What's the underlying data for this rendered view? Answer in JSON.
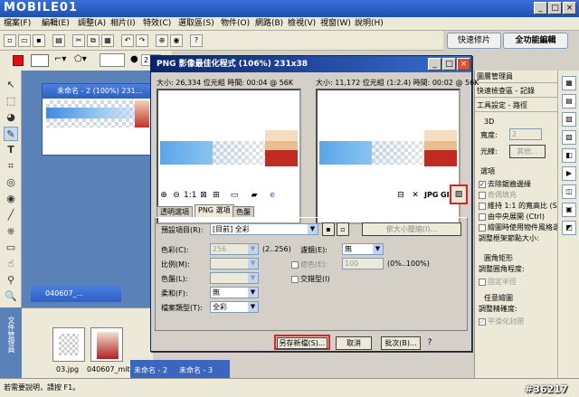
{
  "app": {
    "logo": "MOBILE01",
    "watermark": "#36217",
    "status": "若需要說明，請按 F1。"
  },
  "menubar": [
    "檔案(F)",
    "編輯(E)",
    "調整(A)",
    "相片(I)",
    "特效(C)",
    "選取區(S)",
    "物件(O)",
    "網路(B)",
    "檢視(V)",
    "視窗(W)",
    "說明(H)"
  ],
  "toolbar": {
    "tab_quick_photo": "快速修片",
    "tab_full_edit": "全功能編輯",
    "zoom_value": "2"
  },
  "documents": {
    "doc1_title": "未命名 - 2 (100%) 231...",
    "doc2_title": "040607_..."
  },
  "file_manager": {
    "side_label": "文件管理員",
    "thumbs": [
      "03.jpg",
      "040607_mit...",
      "未命名 - 2",
      "未命名 - 3"
    ]
  },
  "dialog": {
    "title": "PNG 影像最佳化程式 (106%) 231x38",
    "left_info": "大小: 26,334 位元組 時間: 00:04 @ 56K",
    "right_info": "大小: 11,172 位元組 (1:2.4) 時間: 00:02 @ 56K",
    "tabs": [
      "透明選項",
      "PNG 選項",
      "色盤"
    ],
    "preset_label": "預設項目(R):",
    "preset_value": "[目前] 全彩",
    "resize_button": "依大小壓縮(I)...",
    "color_label": "色彩(C):",
    "color_value": "256",
    "color_range": "(2..256)",
    "filter_label": "濾鏡(E):",
    "filter_value": "無",
    "ratio_label": "比例(M):",
    "transparent_label": "遮色(E):",
    "transparent_value": "100",
    "transparent_range": "(0%..100%)",
    "palette_label": "色盤(L):",
    "interlace_label": "交錯型(I)",
    "soft_label": "柔和(F):",
    "soft_value": "無",
    "filetype_label": "檔案類型(T):",
    "filetype_value": "全彩",
    "save_button": "另存新檔(S)...",
    "cancel_button": "取消",
    "batch_button": "批次(B)...",
    "jpg_label": "JPG",
    "gif_label": "GIF"
  },
  "right_panels": {
    "layer_manager": "圖層管理員",
    "quick_select": "快速檢查區 - 記錄",
    "tool_settings": "工具設定 - 路徑",
    "section_3d": "3D",
    "width_label": "寬度:",
    "width_value": "2",
    "light_label": "光線:",
    "light_value": "其他...",
    "options_heading": "選項",
    "opt1": "去除鋸齒邊緣",
    "opt2": "奇偶填充",
    "opt3": "維持 1:1 的寬高比 (Shif",
    "opt4": "由中央展開 (Ctrl)",
    "opt5": "繪圖時使用物件風格選擇",
    "opt6": "調整框架節點大小:",
    "rounded_heading": "圓角矩形",
    "round_label": "調整圓角程度:",
    "fixed_half": "固定半徑",
    "any_heading": "任意繪圖",
    "smooth_label": "調整精確度:",
    "smooth_close": "平滑化封閉"
  },
  "colors": {
    "fg": "#e01010",
    "accent": "#2f5fc4",
    "highlight": "#e02020"
  }
}
